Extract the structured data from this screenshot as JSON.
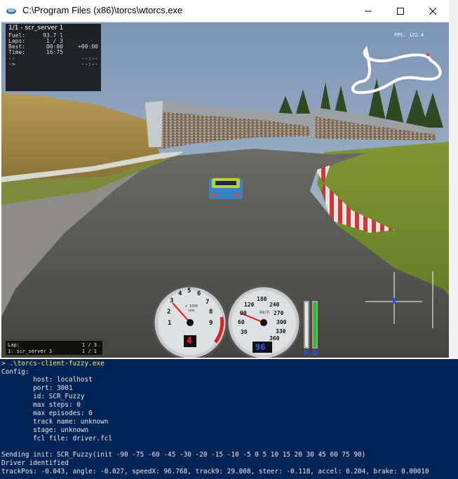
{
  "window": {
    "title": "C:\\Program Files (x86)\\torcs\\wtorcs.exe"
  },
  "hud": {
    "title": "1/1 - scr_server 1",
    "rows": [
      {
        "label": "Fuel:",
        "value": "93.7 l",
        "extra": ""
      },
      {
        "label": "Laps:",
        "value": "1 / 3",
        "extra": ""
      },
      {
        "label": "Best:",
        "value": "00:00",
        "extra": "+00:00"
      },
      {
        "label": "Time:",
        "value": "16:75",
        "extra": ""
      },
      {
        "label": "--",
        "value": "",
        "extra": "--:--"
      },
      {
        "label": "->",
        "value": "",
        "extra": "--:--"
      }
    ],
    "fps": "FPS: 122.4",
    "lap_box": {
      "label": "Lap:",
      "value": "1 / 3",
      "driver": "1: scr_server 1",
      "driver_pos": "1 / 1"
    }
  },
  "tachometer": {
    "ticks": [
      "1",
      "2",
      "3",
      "4",
      "5",
      "6",
      "7",
      "8",
      "9"
    ],
    "unit_top": "x 1000",
    "unit_bottom": "rpm",
    "gear": "4"
  },
  "speedometer": {
    "ticks": [
      "30",
      "60",
      "90",
      "120",
      "180",
      "240",
      "270",
      "300",
      "330",
      "360"
    ],
    "unit": "km/h",
    "speed": "96"
  },
  "bars": {
    "fuel_label": "F",
    "damage_label": "D"
  },
  "console": {
    "command": "> .\\torcs-client-fuzzy.exe",
    "lines": [
      "Config:",
      "        host: localhost",
      "        port: 3001",
      "        id: SCR_Fuzzy",
      "        max steps: 0",
      "        max episodes: 0",
      "        track name: unknown",
      "        stage: unknown",
      "        fcl file: driver.fcl",
      "",
      "Sending init: SCR_Fuzzy(init -90 -75 -60 -45 -30 -20 -15 -10 -5 0 5 10 15 20 30 45 60 75 90)",
      "Driver identified",
      "trackPos: -0.043, angle: -0.027, speedX: 96.768, track9: 29.008, steer: -0.118, accel: 0.204, brake: 0.00010"
    ]
  },
  "colors": {
    "console_bg": "#012456",
    "prompt": "#f5f56a",
    "sky": "#7f97b3",
    "grass": "#6f8a2a",
    "asphalt": "#4b4b48"
  }
}
